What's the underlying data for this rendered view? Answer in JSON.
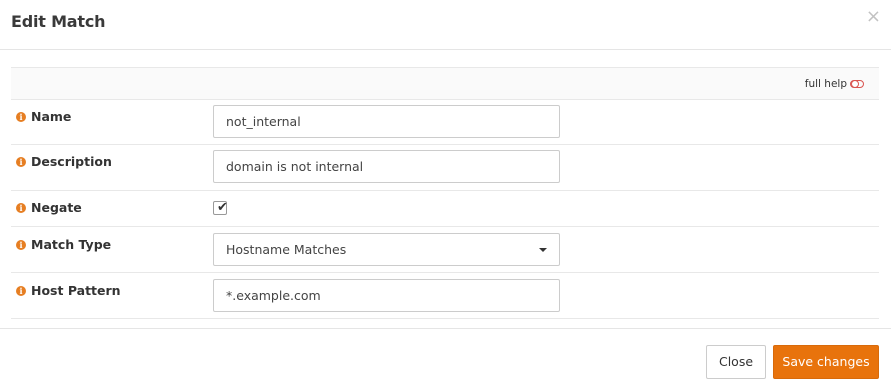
{
  "modal": {
    "title": "Edit Match",
    "close_symbol": "×"
  },
  "help": {
    "label": "full help",
    "icon": "toggle-off-icon",
    "icon_color": "#d9534f"
  },
  "fields": {
    "name": {
      "label": "Name",
      "value": "not_internal"
    },
    "description": {
      "label": "Description",
      "value": "domain is not internal"
    },
    "negate": {
      "label": "Negate",
      "checked": true,
      "mark": "✔"
    },
    "match_type": {
      "label": "Match Type",
      "selected": "Hostname Matches"
    },
    "host_pattern": {
      "label": "Host Pattern",
      "value": "*.example.com"
    }
  },
  "info_icon": {
    "glyph": "i",
    "color": "#e67e22"
  },
  "footer": {
    "close_label": "Close",
    "save_label": "Save changes",
    "save_color": "#e8730c"
  }
}
